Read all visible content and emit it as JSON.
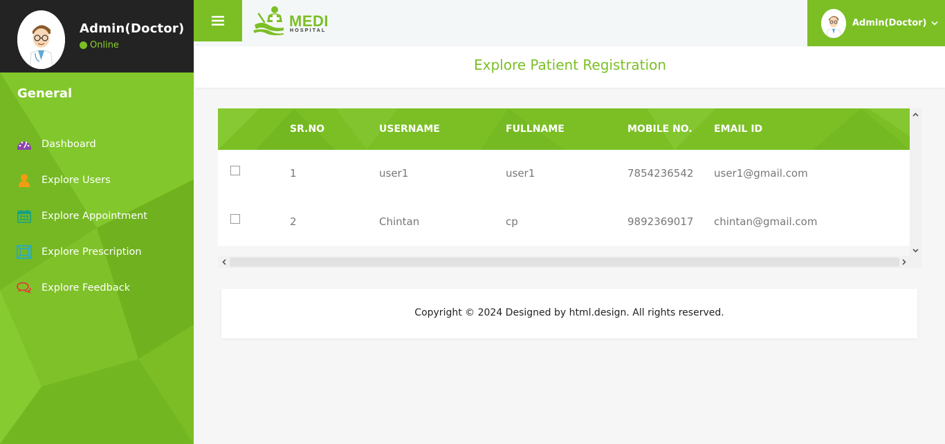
{
  "sidebar": {
    "profile": {
      "name": "Admin(Doctor)",
      "status": "Online"
    },
    "section_title": "General",
    "items": [
      {
        "label": "Dashboard",
        "icon": "dashboard-icon",
        "color": "#8e44ad"
      },
      {
        "label": "Explore Users",
        "icon": "user-icon",
        "color": "#f39c12"
      },
      {
        "label": "Explore Appointment",
        "icon": "calendar-icon",
        "color": "#16a085"
      },
      {
        "label": "Explore Prescription",
        "icon": "prescription-icon",
        "color": "#1fa7e0"
      },
      {
        "label": "Explore Feedback",
        "icon": "comments-icon",
        "color": "#e23b3b"
      }
    ]
  },
  "topbar": {
    "logo_text": "MEDI",
    "logo_subtext": "HOSPITAL",
    "user_name": "Admin(Doctor)"
  },
  "page": {
    "title": "Explore Patient Registration"
  },
  "table": {
    "columns": [
      "SR.NO",
      "USERNAME",
      "FULLNAME",
      "MOBILE NO.",
      "EMAIL ID"
    ],
    "rows": [
      {
        "srno": "1",
        "username": "user1",
        "fullname": "user1",
        "mobile": "7854236542",
        "email": "user1@gmail.com"
      },
      {
        "srno": "2",
        "username": "Chintan",
        "fullname": "cp",
        "mobile": "9892369017",
        "email": "chintan@gmail.com"
      }
    ]
  },
  "footer": {
    "text": "Copyright © 2024 Designed by html.design. All rights reserved."
  },
  "colors": {
    "accent": "#7bbf25",
    "dark": "#232323",
    "text_muted": "#777777"
  }
}
